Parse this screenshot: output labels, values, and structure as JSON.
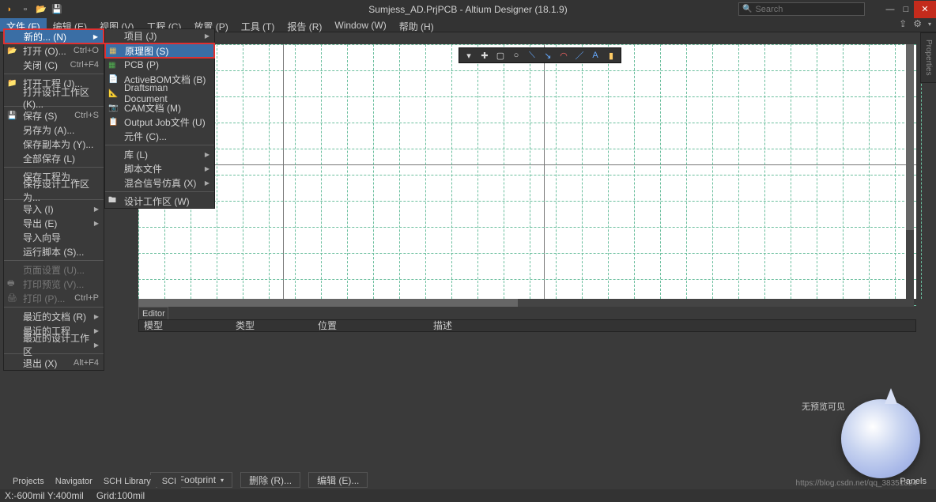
{
  "title": "Sumjess_AD.PrjPCB - Altium Designer (18.1.9)",
  "search": {
    "placeholder": "Search"
  },
  "menubar": {
    "file": "文件 (F)",
    "edit": "编辑 (E)",
    "view": "视图 (V)",
    "project": "工程 (C)",
    "place": "放置 (P)",
    "tools": "工具 (T)",
    "report": "报告 (R)",
    "window": "Window (W)",
    "help": "帮助 (H)"
  },
  "menu1": {
    "new": "新的... (N)",
    "open": "打开 (O)...",
    "open_sc": "Ctrl+O",
    "close": "关闭 (C)",
    "close_sc": "Ctrl+F4",
    "open_proj": "打开工程 (J)...",
    "open_ws": "打开设计工作区 (K)...",
    "save": "保存 (S)",
    "save_sc": "Ctrl+S",
    "save_as": "另存为 (A)...",
    "save_copy": "保存副本为 (Y)...",
    "save_all": "全部保存 (L)",
    "save_proj": "保存工程为...",
    "save_ws": "保存设计工作区为...",
    "import": "导入 (I)",
    "export": "导出 (E)",
    "import_wiz": "导入向导",
    "run_script": "运行脚本 (S)...",
    "page_setup": "页面设置 (U)...",
    "print_preview": "打印预览 (V)...",
    "print": "打印 (P)...",
    "print_sc": "Ctrl+P",
    "recent_docs": "最近的文档 (R)",
    "recent_proj": "最近的工程",
    "recent_ws": "最近的设计工作区",
    "exit": "退出 (X)",
    "exit_sc": "Alt+F4"
  },
  "menu2": {
    "project": "项目 (J)",
    "schematic": "原理图 (S)",
    "pcb": "PCB (P)",
    "activebom": "ActiveBOM文档 (B)",
    "draftsman": "Draftsman Document",
    "cam": "CAM文档 (M)",
    "outputjob": "Output Job文件 (U)",
    "component": "元件 (C)...",
    "library": "库 (L)",
    "script": "脚本文件",
    "mixedsim": "混合信号仿真 (X)",
    "workspace": "设计工作区 (W)"
  },
  "editor": {
    "tab": "Editor",
    "cols": {
      "model": "模型",
      "type": "类型",
      "location": "位置",
      "desc": "描述"
    },
    "no_preview": "无预览可见"
  },
  "buttons": {
    "add_footprint": "Add Footprint",
    "remove": "删除 (R)...",
    "edit": "编辑 (E)..."
  },
  "bottom_tabs": {
    "projects": "Projects",
    "navigator": "Navigator",
    "sch_library": "SCH Library",
    "sch": "SCI"
  },
  "statusbar": {
    "coords": "X:-600mil Y:400mil",
    "grid": "Grid:100mil"
  },
  "watermark": "https://blog.csdn.net/qq_38351824",
  "panels": "Panels",
  "right_tab": "Properties"
}
